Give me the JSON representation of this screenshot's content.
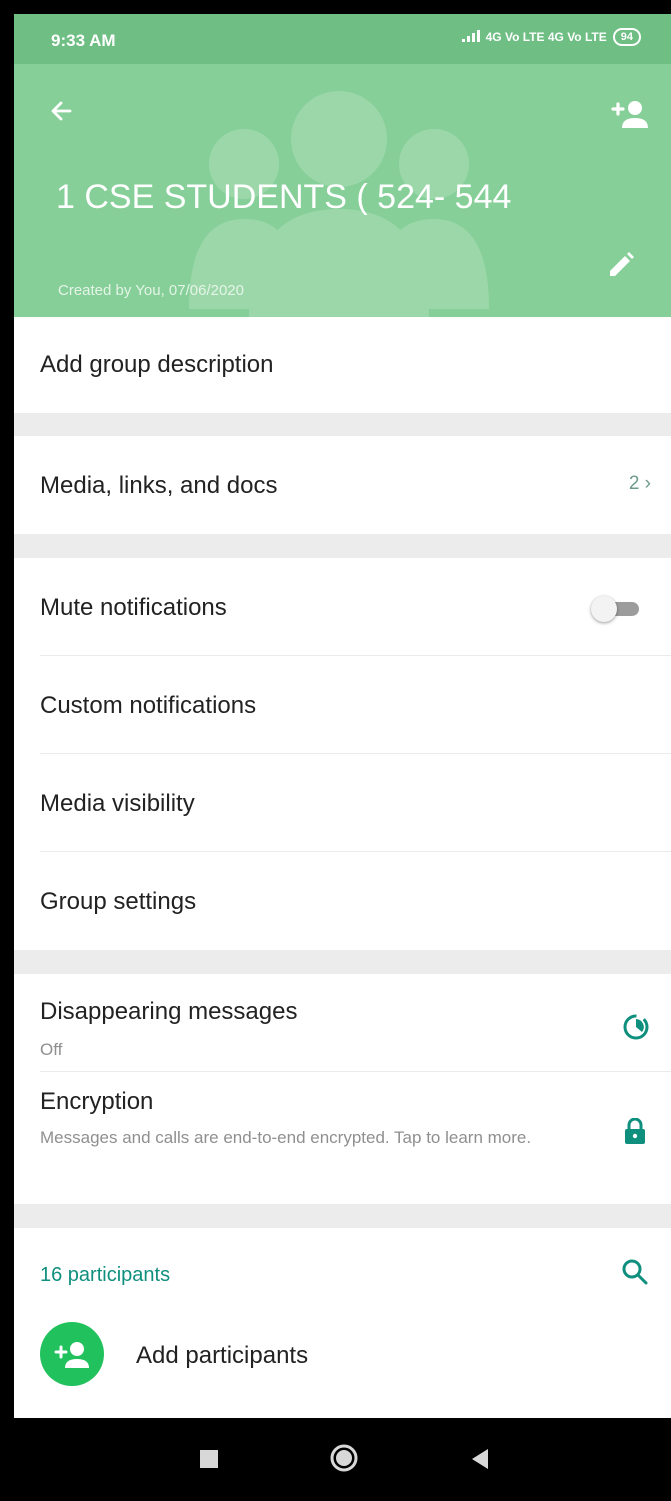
{
  "status_bar": {
    "time": "9:33 AM",
    "network": "4G Vo LTE 4G Vo LTE",
    "battery": "94"
  },
  "header": {
    "title": "1 CSE STUDENTS ( 524- 544",
    "created": "Created by You, 07/06/2020",
    "back_icon": "arrow-left-icon",
    "add_participant_icon": "person-add-icon",
    "edit_icon": "pencil-icon",
    "background_icon": "group-people-icon"
  },
  "description": {
    "label": "Add group description"
  },
  "media": {
    "label": "Media, links, and docs",
    "count": "2"
  },
  "settings": {
    "mute_label": "Mute notifications",
    "mute_on": false,
    "custom_label": "Custom notifications",
    "media_visibility_label": "Media visibility",
    "group_settings_label": "Group settings"
  },
  "privacy": {
    "disappearing_label": "Disappearing messages",
    "disappearing_value": "Off",
    "encryption_label": "Encryption",
    "encryption_desc": "Messages and calls are end-to-end encrypted. Tap to learn more."
  },
  "participants": {
    "count_label": "16 participants",
    "add_label": "Add participants"
  },
  "colors": {
    "header_bg": "#86cf98",
    "accent_teal": "#0f8f7e",
    "add_green": "#21c25e"
  }
}
